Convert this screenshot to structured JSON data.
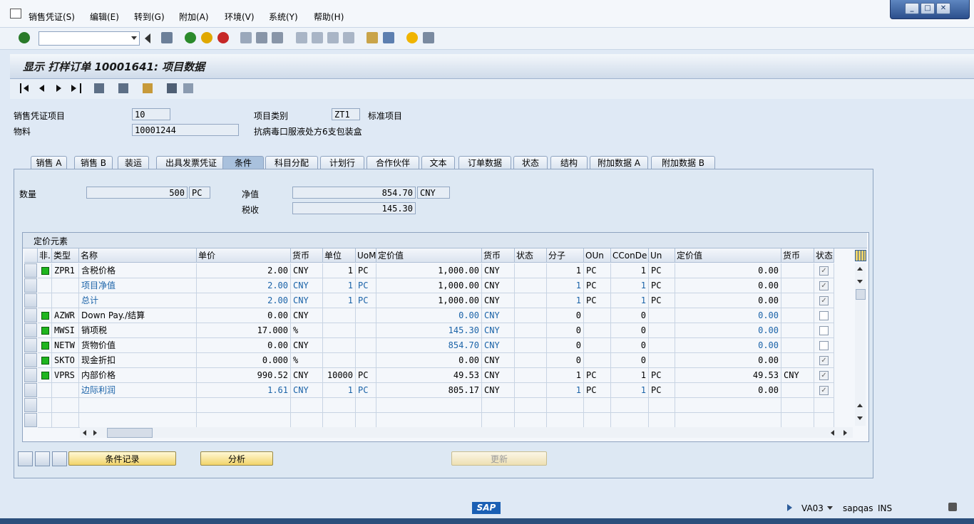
{
  "menu": {
    "items": [
      "销售凭证(S)",
      "编辑(E)",
      "转到(G)",
      "附加(A)",
      "环境(V)",
      "系统(Y)",
      "帮助(H)"
    ]
  },
  "window_controls": {
    "minimize": "_",
    "restore": "□",
    "close": "✕"
  },
  "screen_title": "显示 打样订单 10001641: 项目数据",
  "header": {
    "item_label": "销售凭证项目",
    "item_value": "10",
    "material_label": "物料",
    "material_value": "10001244",
    "material_desc": "抗病毒口服液处方6支包装盒",
    "item_cat_label": "项目类别",
    "item_cat_value": "ZT1",
    "item_cat_desc": "标准项目"
  },
  "tabs": [
    "销售 A",
    "销售 B",
    "装运",
    "出具发票凭证",
    "条件",
    "科目分配",
    "计划行",
    "合作伙伴",
    "文本",
    "订单数据",
    "状态",
    "结构",
    "附加数据 A",
    "附加数据 B"
  ],
  "active_tab": "条件",
  "conditions": {
    "qty_label": "数量",
    "qty_value": "500",
    "qty_unit": "PC",
    "net_label": "净值",
    "net_value": "854.70",
    "net_currency": "CNY",
    "tax_label": "税收",
    "tax_value": "145.30"
  },
  "grid": {
    "title": "定价元素",
    "columns": [
      "非.",
      "类型",
      "名称",
      "单价",
      "货币",
      "单位",
      "UoM",
      "定价值",
      "货币",
      "状态",
      "分子",
      "OUn",
      "CConDe",
      "Un",
      "定价值",
      "货币",
      "状态"
    ],
    "rows": [
      {
        "light": true,
        "type": "ZPR1",
        "name": "含税价格",
        "price": "2.00",
        "curr": "CNY",
        "per": "1",
        "uom": "PC",
        "value": "1,000.00",
        "vcurr": "CNY",
        "num": "1",
        "oun": "PC",
        "ccon": "1",
        "un": "PC",
        "value2": "0.00",
        "curr2": "",
        "checked": true,
        "blue": false
      },
      {
        "light": false,
        "type": "",
        "name": "项目净值",
        "price": "2.00",
        "curr": "CNY",
        "per": "1",
        "uom": "PC",
        "value": "1,000.00",
        "vcurr": "CNY",
        "num": "1",
        "oun": "PC",
        "ccon": "1",
        "un": "PC",
        "value2": "0.00",
        "curr2": "",
        "checked": true,
        "blue": true
      },
      {
        "light": false,
        "type": "",
        "name": "总计",
        "price": "2.00",
        "curr": "CNY",
        "per": "1",
        "uom": "PC",
        "value": "1,000.00",
        "vcurr": "CNY",
        "num": "1",
        "oun": "PC",
        "ccon": "1",
        "un": "PC",
        "value2": "0.00",
        "curr2": "",
        "checked": true,
        "blue": true
      },
      {
        "light": true,
        "type": "AZWR",
        "name": "Down Pay./结算",
        "price": "0.00",
        "curr": "CNY",
        "per": "",
        "uom": "",
        "value": "0.00",
        "vcurr": "CNY",
        "num": "0",
        "oun": "",
        "ccon": "0",
        "un": "",
        "value2": "0.00",
        "curr2": "",
        "checked": false,
        "blue": false,
        "bluevalue": true
      },
      {
        "light": true,
        "type": "MWSI",
        "name": "销项税",
        "price": "17.000",
        "curr": "%",
        "per": "",
        "uom": "",
        "value": "145.30",
        "vcurr": "CNY",
        "num": "0",
        "oun": "",
        "ccon": "0",
        "un": "",
        "value2": "0.00",
        "curr2": "",
        "checked": false,
        "blue": false,
        "bluevalue": true
      },
      {
        "light": true,
        "type": "NETW",
        "name": "货物价值",
        "price": "0.00",
        "curr": "CNY",
        "per": "",
        "uom": "",
        "value": "854.70",
        "vcurr": "CNY",
        "num": "0",
        "oun": "",
        "ccon": "0",
        "un": "",
        "value2": "0.00",
        "curr2": "",
        "checked": false,
        "blue": false,
        "bluevalue": true
      },
      {
        "light": true,
        "type": "SKTO",
        "name": "现金折扣",
        "price": "0.000",
        "curr": "%",
        "per": "",
        "uom": "",
        "value": "0.00",
        "vcurr": "CNY",
        "num": "0",
        "oun": "",
        "ccon": "0",
        "un": "",
        "value2": "0.00",
        "curr2": "",
        "checked": true,
        "blue": false
      },
      {
        "light": true,
        "type": "VPRS",
        "name": "内部价格",
        "price": "990.52",
        "curr": "CNY",
        "per": "10000",
        "uom": "PC",
        "value": "49.53",
        "vcurr": "CNY",
        "num": "1",
        "oun": "PC",
        "ccon": "1",
        "un": "PC",
        "value2": "49.53",
        "curr2": "CNY",
        "checked": true,
        "blue": false
      },
      {
        "light": false,
        "type": "",
        "name": "边际利润",
        "price": "1.61",
        "curr": "CNY",
        "per": "1",
        "uom": "PC",
        "value": "805.17",
        "vcurr": "CNY",
        "num": "1",
        "oun": "PC",
        "ccon": "1",
        "un": "PC",
        "value2": "0.00",
        "curr2": "",
        "checked": true,
        "blue": true
      }
    ]
  },
  "buttons": {
    "cond_record": "条件记录",
    "analysis": "分析",
    "update": "更新"
  },
  "status": {
    "logo": "SAP",
    "tcode": "VA03",
    "server": "sapqas",
    "mode": "INS"
  },
  "colors": {
    "accent": "#1b63a8",
    "light_green": "#1fb51f",
    "button_yellow": "#f2d46a"
  },
  "icons": [
    "enter-icon",
    "save-icon",
    "back-icon",
    "exit-icon",
    "cancel-icon",
    "print-icon",
    "find-icon",
    "help-icon",
    "first-page-icon",
    "prev-page-icon",
    "next-page-icon",
    "last-page-icon"
  ]
}
